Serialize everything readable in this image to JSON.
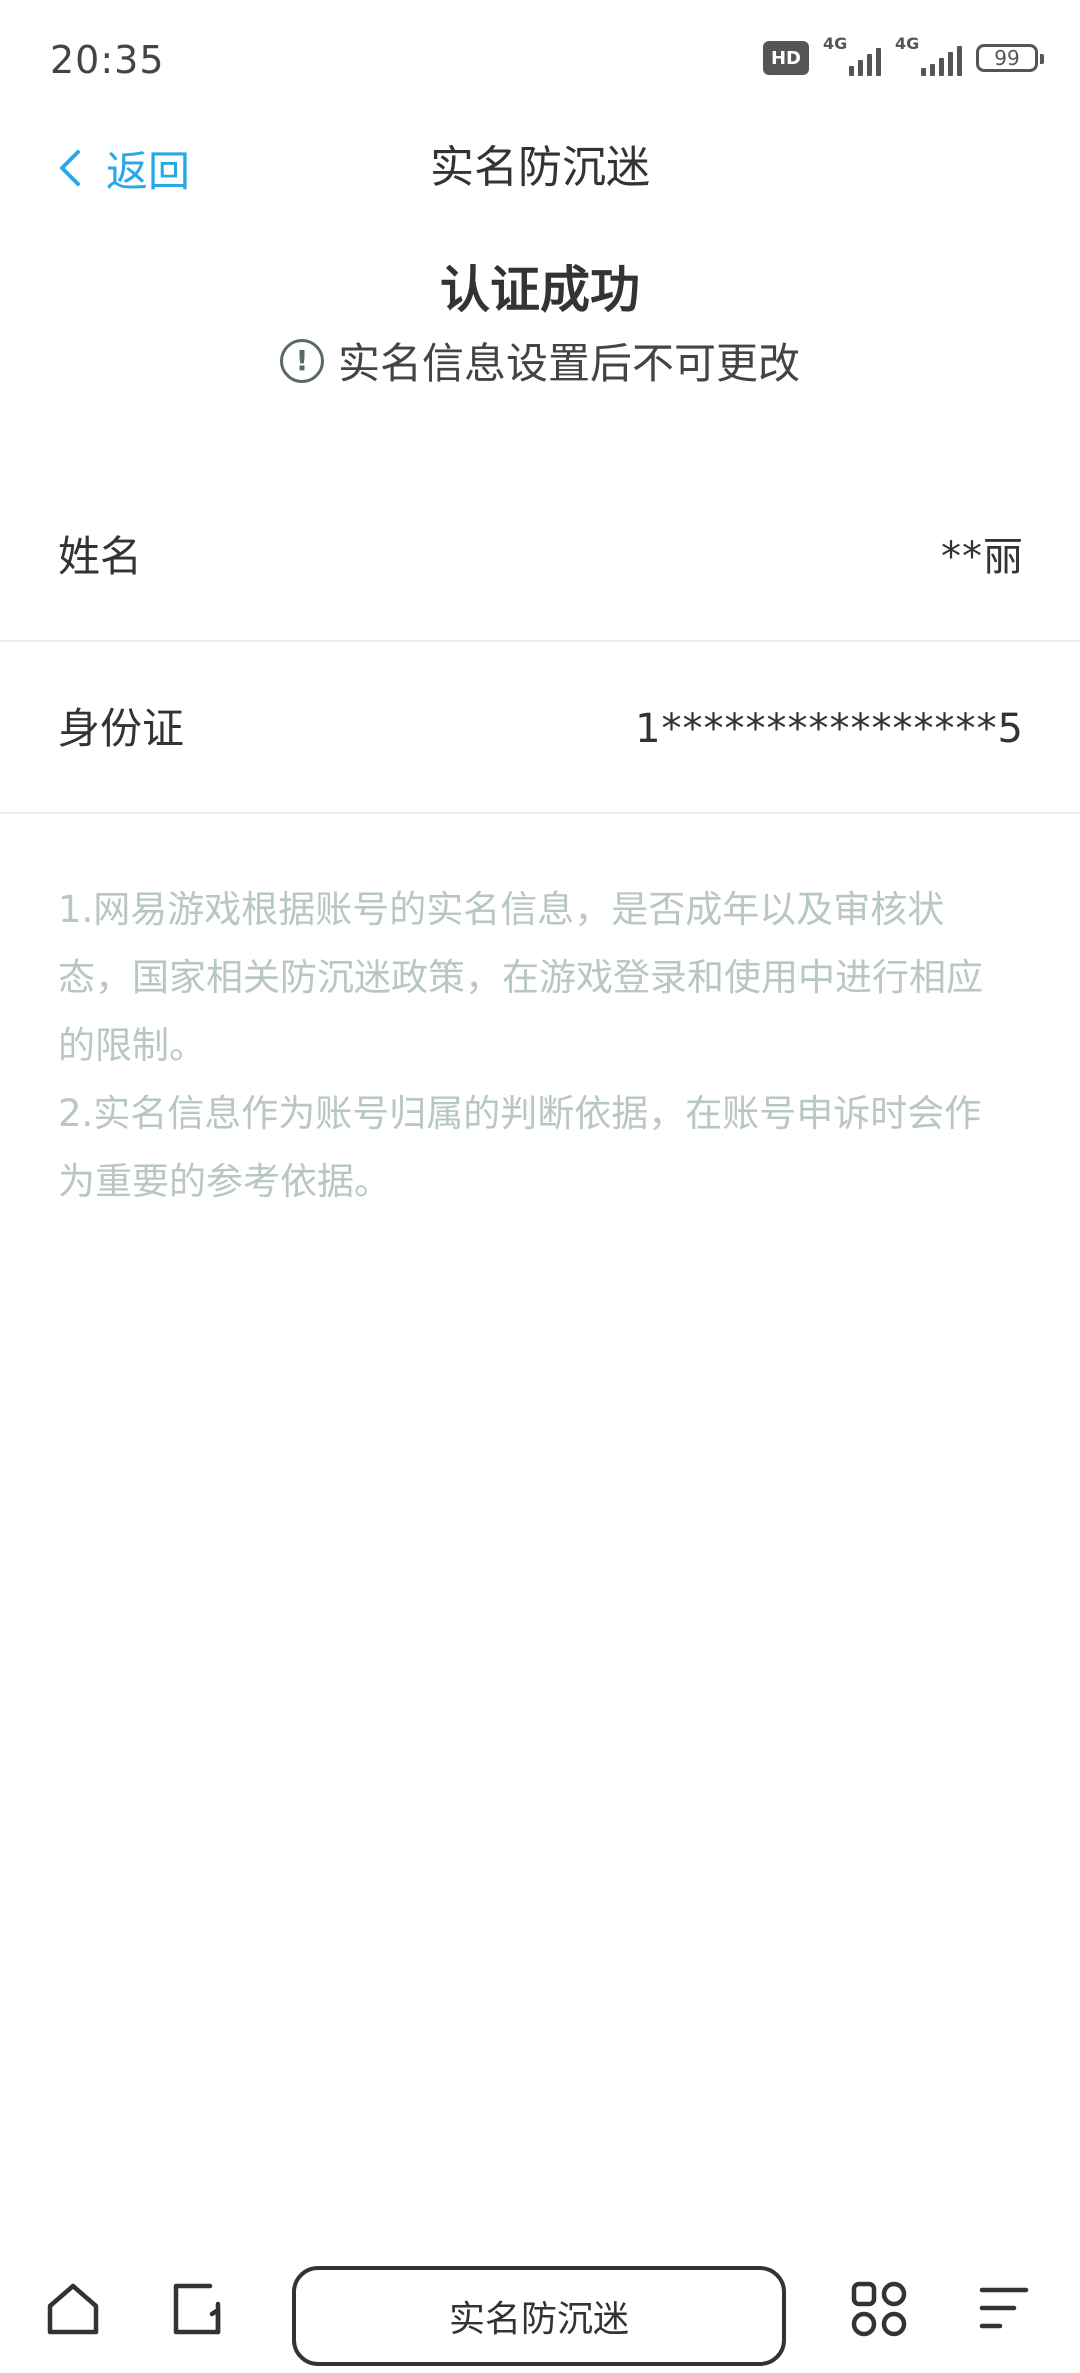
{
  "status_bar": {
    "time": "20:35",
    "hd_badge": "HD",
    "network1_label": "4G",
    "network2_label": "4G",
    "battery_level": "99"
  },
  "nav": {
    "back_label": "返回",
    "title": "实名防沉迷"
  },
  "success": {
    "title": "认证成功",
    "notice": "实名信息设置后不可更改"
  },
  "info": {
    "name_label": "姓名",
    "name_value": "**丽",
    "id_label": "身份证",
    "id_value": "1****************5"
  },
  "description": [
    "1.网易游戏根据账号的实名信息，是否成年以及审核状态，国家相关防沉迷政策，在游戏登录和使用中进行相应的限制。",
    "2.实名信息作为账号归属的判断依据，在账号申诉时会作为重要的参考依据。"
  ],
  "bottom_nav": {
    "pill_label": "实名防沉迷"
  },
  "colors": {
    "accent": "#29a8e8",
    "desc_text": "#b8c7bf"
  }
}
